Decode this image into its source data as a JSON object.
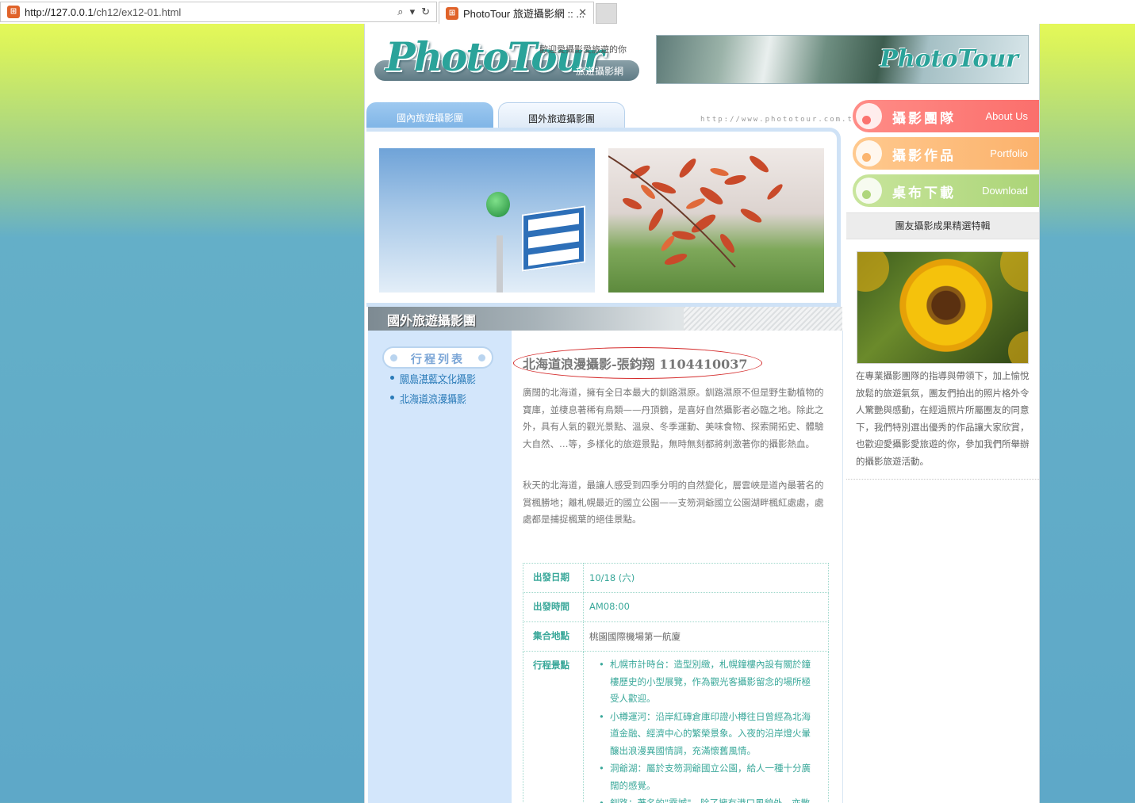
{
  "browser": {
    "url_host": "http://127.0.0.1",
    "url_path": "/ch12/ex12-01.html",
    "tab_title": "PhotoTour 旅遊攝影網 :: ...",
    "close_glyph": "✕"
  },
  "header": {
    "logo_text": "PhotoTour",
    "slogan": "歡迎愛攝影愛旅遊的你",
    "subtitle": "旅遊攝影網",
    "banner_logo": "PhotoTour"
  },
  "tabs": [
    {
      "label": "國內旅遊攝影團"
    },
    {
      "label": "國外旅遊攝影團"
    }
  ],
  "site_url": "http://www.phototour.com.tw",
  "section": {
    "title": "國外旅遊攝影團"
  },
  "trip_list": {
    "title": "行程列表",
    "items": [
      "關島湛藍文化攝影",
      "北海道浪漫攝影"
    ]
  },
  "article": {
    "title": "北海道浪漫攝影-張鈞翔 1104410037",
    "para1": "廣闊的北海道，擁有全日本最大的釧路濕原。釧路濕原不但是野生動植物的寶庫，並棲息著稀有鳥類——丹頂鶴，是喜好自然攝影者必臨之地。除此之外，具有人氣的觀光景點、溫泉、冬季運動、美味食物、探索開拓史、體驗大自然、…等，多樣化的旅遊景點，無時無刻都將刺激著你的攝影熱血。",
    "para2": "秋天的北海道，最讓人感受到四季分明的自然變化，層雲峽是道內最著名的賞楓勝地；離札幌最近的國立公園——支笏洞爺國立公園湖畔楓紅處處，處處都是捕捉楓葉的絕佳景點。",
    "info": {
      "date_label": "出發日期",
      "date_value": "10/18 (六)",
      "time_label": "出發時間",
      "time_value": "AM08:00",
      "place_label": "集合地點",
      "place_value": "桃園國際機場第一航廈",
      "spots_label": "行程景點",
      "spots": [
        "札幌市計時台：造型別緻，札幌鐘樓內設有關於鐘樓歷史的小型展覽，作為觀光客攝影留念的場所極受人歡迎。",
        "小樽運河：沿岸紅磚倉庫印證小樽往日曾經為北海道金融、經濟中心的繁榮景象。入夜的沿岸燈火暈釀出浪漫異國情調，充滿懷舊風情。",
        "洞爺湖：屬於支笏洞爺國立公園，給人一種十分廣闊的感覺。",
        "釧路：著名的\"霧城\"，除了擁有港口風貌外，亦散發著濃厚的文學氣氛。"
      ]
    }
  },
  "sidebar": {
    "menu": [
      {
        "zh": "攝影團隊",
        "en": "About Us"
      },
      {
        "zh": "攝影作品",
        "en": "Portfolio"
      },
      {
        "zh": "桌布下載",
        "en": "Download"
      }
    ],
    "feature_title": "團友攝影成果精選特輯",
    "feature_text": "在專業攝影團隊的指導與帶領下，加上愉悅放鬆的旅遊氣氛，團友們拍出的照片格外令人驚艷與感動，在經過照片所屬團友的同意下，我們特別選出優秀的作品讓大家欣賞，也歡迎愛攝影愛旅遊的你，參加我們所舉辦的攝影旅遊活動。"
  }
}
